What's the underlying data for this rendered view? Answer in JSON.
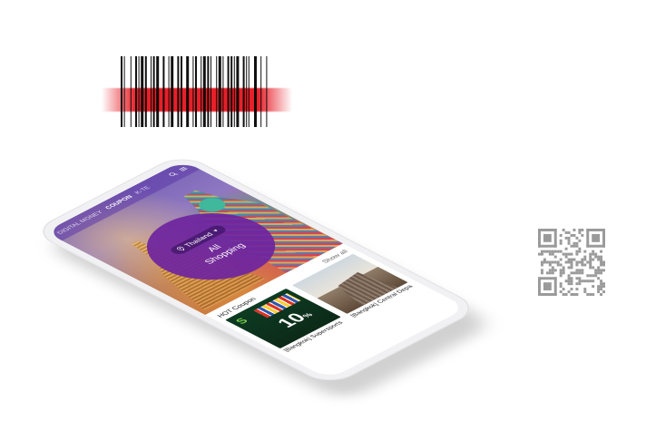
{
  "header": {
    "tabs": [
      {
        "label": "DIGITAL MONEY",
        "active": false
      },
      {
        "label": "COUPON",
        "active": true
      },
      {
        "label": "K-TE",
        "active": false
      }
    ]
  },
  "hero": {
    "region": "Thailand",
    "category": "All Shopping"
  },
  "section": {
    "title": "HOT Coupon",
    "show_all": "Show all"
  },
  "coupons": [
    {
      "name": "[Bangkok] Supersports",
      "discount": "10",
      "unit": "%"
    },
    {
      "name": "[Bangkok] Central Depa"
    }
  ],
  "colors": {
    "brand_purple": "#6e24a0",
    "header_purple": "#5c38aa",
    "scan_red": "#e6141e"
  },
  "icons": {
    "location": "location-pin-icon",
    "dropdown": "caret-down-icon",
    "search": "search-icon",
    "menu": "hamburger-menu-icon"
  }
}
